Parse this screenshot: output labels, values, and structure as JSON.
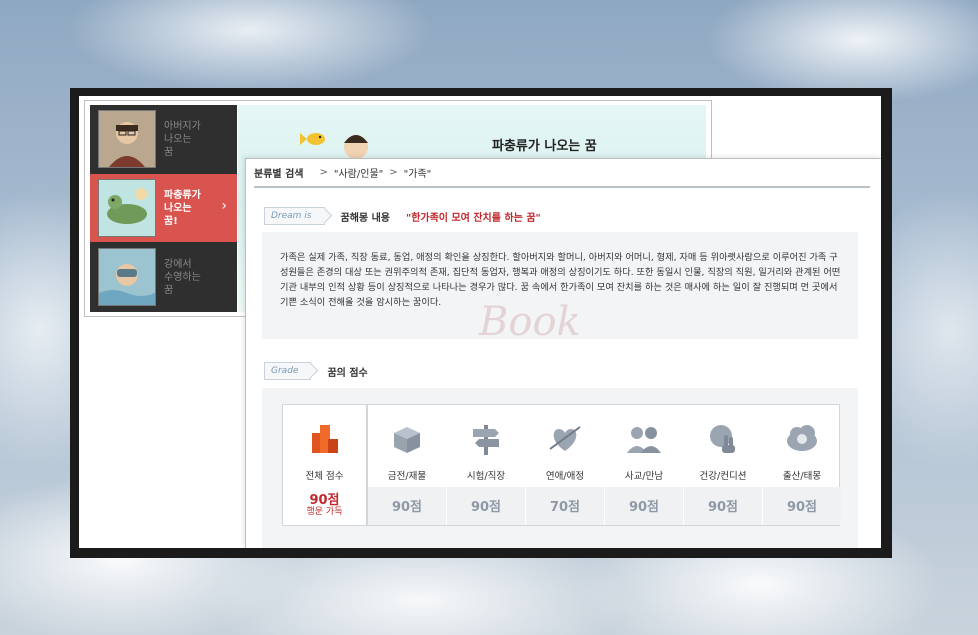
{
  "dream_list": [
    {
      "label": "아버지가\n나오는\n꿈",
      "active": false
    },
    {
      "label": "파충류가\n나오는\n꿈!",
      "active": true
    },
    {
      "label": "강에서\n수영하는\n꿈",
      "active": false
    }
  ],
  "banner": {
    "title": "파충류가 나오는 꿈"
  },
  "breadcrumb": {
    "title": "분류별 검색",
    "items": [
      "\"사람/인물\"",
      "\"가족\""
    ]
  },
  "dream_content": {
    "tag": "Dream is",
    "label": "꿈해몽 내용",
    "quote": "\"한가족이 모여 잔치를 하는 꿈\"",
    "description": "가족은 실제 가족, 직장 동료, 동업, 애정의 확인을 상징한다. 할아버지와 할머니, 아버지와 어머니, 형제, 자매 등 위아랫사람으로 이루어진 가족 구성원들은 존경의 대상 또는 권위주의적 존재, 집단적 동업자, 행복과 애정의 상징이기도 하다. 또한 동일시 인물, 직장의 직원, 일거리와 관계된 어떤 기관 내부의 인적 상황 등이 상징적으로 나타나는 경우가 많다. 꿈 속에서 한가족이 모여 잔치를 하는 것은 매사에 하는 일이 잘 진행되며 먼 곳에서 기쁜 소식이 전해올 것을 암시하는 꿈이다."
  },
  "grade": {
    "tag": "Grade",
    "label": "꿈의 점수",
    "total": {
      "label": "전체 점수",
      "score": "90점",
      "note": "행운 가득"
    },
    "categories": [
      {
        "label": "금전/재물",
        "score": "90점",
        "icon": "gift-box-icon"
      },
      {
        "label": "시험/직장",
        "score": "90점",
        "icon": "signpost-icon"
      },
      {
        "label": "연애/애정",
        "score": "70점",
        "icon": "heart-arrow-icon"
      },
      {
        "label": "사교/만남",
        "score": "90점",
        "icon": "people-icon"
      },
      {
        "label": "건강/컨디션",
        "score": "90점",
        "icon": "hand-globe-icon"
      },
      {
        "label": "출산/태몽",
        "score": "90점",
        "icon": "baby-cloud-icon"
      }
    ]
  },
  "watermark": {
    "text": "Book"
  },
  "colors": {
    "accent_red": "#c0282c",
    "active_item": "#d9534f",
    "sidebar": "#2f2f2f"
  }
}
